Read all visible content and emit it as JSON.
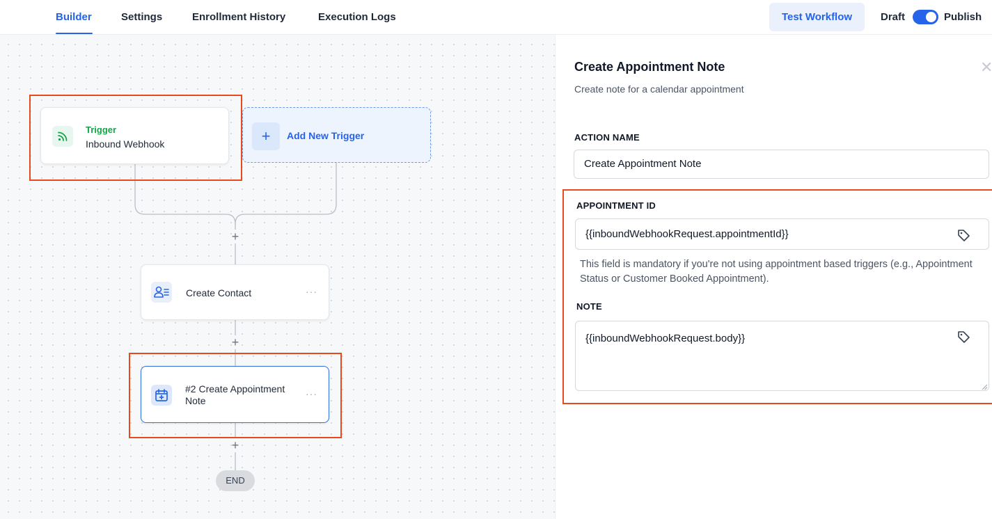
{
  "tabs": {
    "builder": "Builder",
    "settings": "Settings",
    "enrollment": "Enrollment History",
    "logs": "Execution Logs"
  },
  "header": {
    "test_button": "Test Workflow",
    "draft_label": "Draft",
    "publish_label": "Publish",
    "publish_toggle_on": true
  },
  "canvas": {
    "trigger": {
      "title": "Trigger",
      "name": "Inbound Webhook",
      "icon": "rss-icon"
    },
    "add_trigger_label": "Add New Trigger",
    "steps": [
      {
        "label": "Create Contact",
        "icon": "contact-list-icon"
      },
      {
        "label": "#2 Create Appointment Note",
        "icon": "calendar-plus-icon"
      }
    ],
    "end_label": "END"
  },
  "panel": {
    "title": "Create Appointment Note",
    "subtitle": "Create note for a calendar appointment",
    "action_name_label": "ACTION NAME",
    "action_name_value": "Create Appointment Note",
    "appointment_id_label": "APPOINTMENT ID",
    "appointment_id_value": "{{inboundWebhookRequest.appointmentId}}",
    "appointment_help": "This field is mandatory if you're not using appointment based triggers (e.g., Appointment Status or Customer Booked Appointment).",
    "note_label": "NOTE",
    "note_value": "{{inboundWebhookRequest.body}}"
  },
  "colors": {
    "accent": "#2563eb",
    "trigger_green": "#16a34a",
    "highlight": "#e8491d"
  }
}
